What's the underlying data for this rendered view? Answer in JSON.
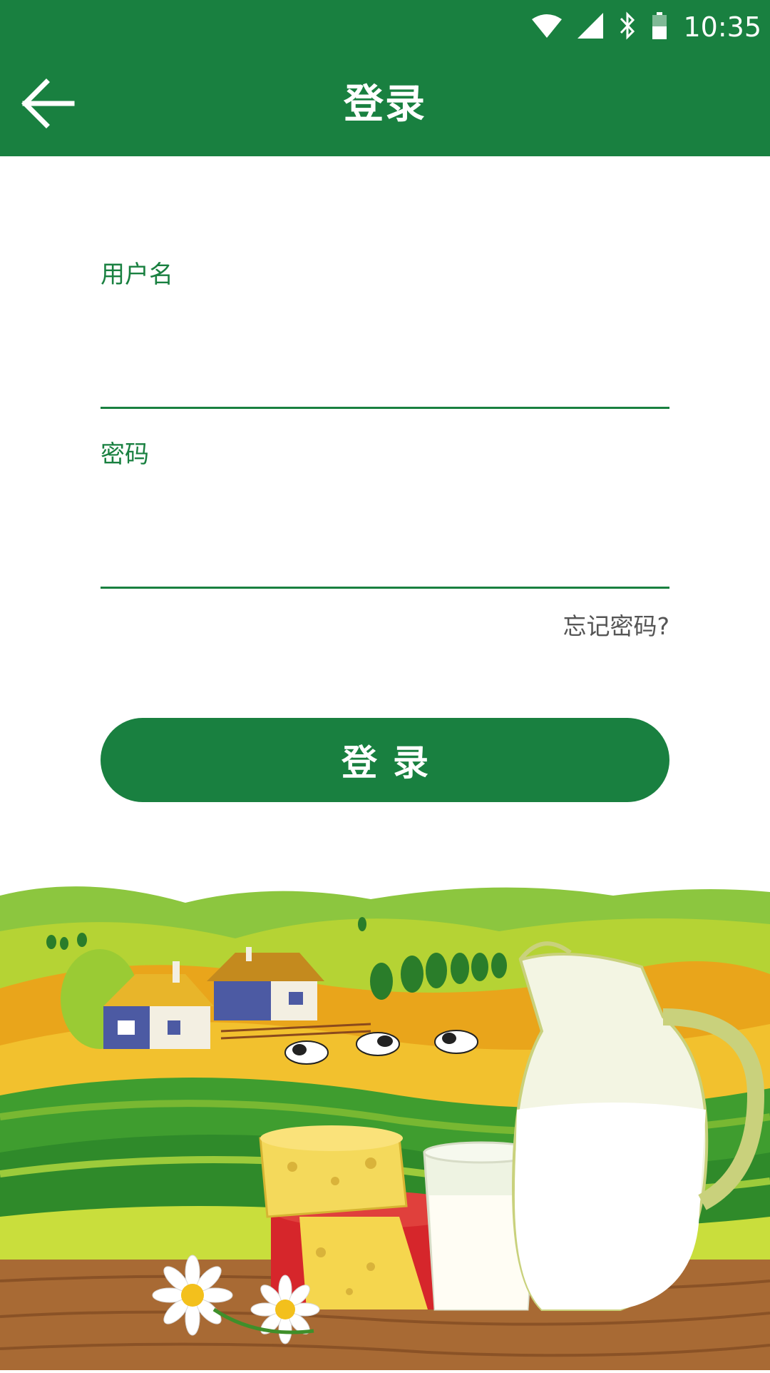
{
  "status_bar": {
    "time": "10:35",
    "icons": [
      "wifi-icon",
      "signal-icon",
      "bluetooth-icon",
      "battery-icon"
    ]
  },
  "app_bar": {
    "title": "登录",
    "back_icon": "arrow-left-icon"
  },
  "form": {
    "username_label": "用户名",
    "username_value": "",
    "password_label": "密码",
    "password_value": "",
    "forgot_password": "忘记密码?",
    "login_button": "登录"
  },
  "illustration": {
    "subject": "farm-dairy-scene"
  },
  "colors": {
    "primary": "#198040",
    "text_muted": "#555555",
    "background": "#ffffff"
  }
}
